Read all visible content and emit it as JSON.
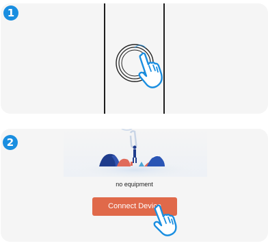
{
  "steps": [
    {
      "number": "1"
    },
    {
      "number": "2"
    }
  ],
  "empty_state": {
    "message": "no equipment"
  },
  "connect_button": {
    "label": "Connect Device"
  },
  "colors": {
    "step_badge": "#1a8ee0",
    "button": "#e0694a",
    "panel_background": "#f5f5f5",
    "hand_outline": "#1a8ee0"
  },
  "icons": {
    "step1_lock": "fingerprint-lock-icon",
    "step1_hand": "tap-hand-icon",
    "step2_hand": "tap-hand-icon"
  }
}
